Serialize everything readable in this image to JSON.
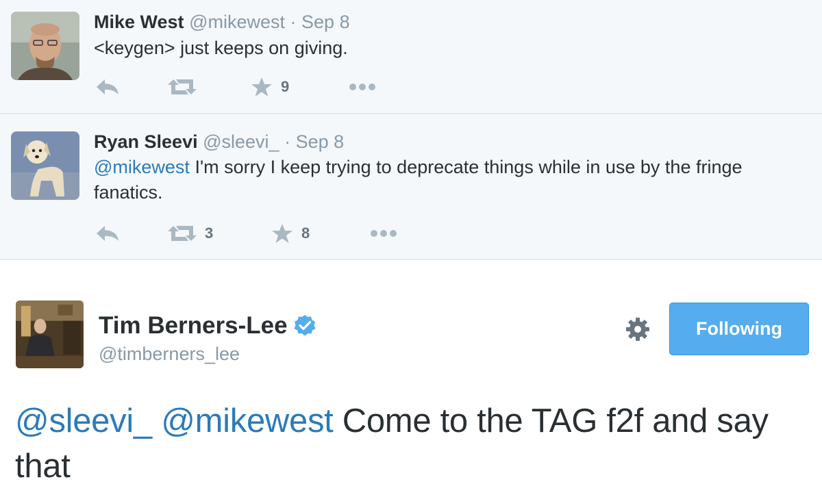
{
  "tweets": [
    {
      "name": "Mike West",
      "handle": "@mikewest",
      "separator": "·",
      "time": "Sep 8",
      "text": "<keygen> just keeps on giving.",
      "retweets": "",
      "favorites": "9",
      "avatar_icon": "person-photo-avatar"
    },
    {
      "name": "Ryan Sleevi",
      "handle": "@sleevi_",
      "separator": "·",
      "time": "Sep 8",
      "mention": "@mikewest",
      "text": " I'm sorry I keep trying to deprecate things while in use by the fringe fanatics.",
      "retweets": "3",
      "favorites": "8",
      "avatar_icon": "dog-photo-avatar"
    }
  ],
  "main": {
    "name": "Tim Berners-Lee",
    "handle": "@timberners_lee",
    "follow_label": "Following",
    "mention1": "@sleevi_",
    "mention2": "@mikewest",
    "text": " Come to the TAG f2f and say that",
    "verified_icon": "verified-badge-icon",
    "settings_icon": "gear-icon"
  },
  "colors": {
    "link": "#2b7bb9",
    "muted": "#8899a6",
    "follow_button": "#55acee",
    "reply_background": "#f5f8fa"
  }
}
